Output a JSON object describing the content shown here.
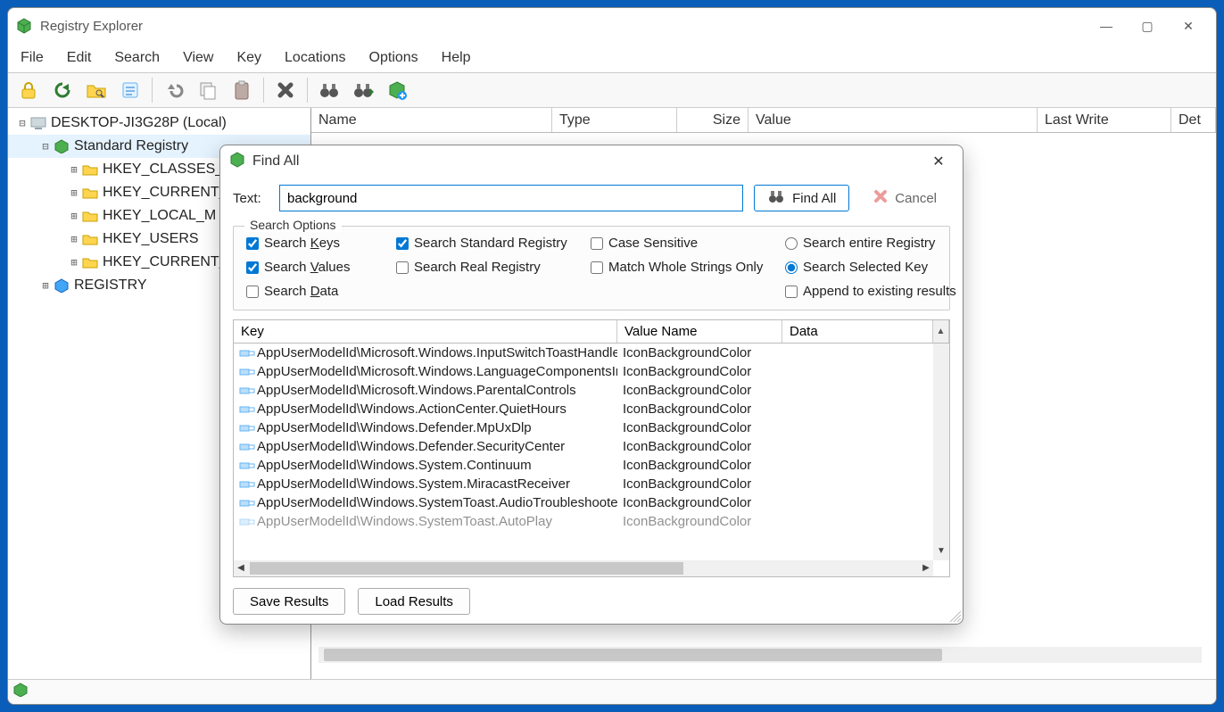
{
  "app": {
    "title": "Registry Explorer"
  },
  "window_controls": {
    "min": "—",
    "max": "▢",
    "close": "✕"
  },
  "menu": [
    "File",
    "Edit",
    "Search",
    "View",
    "Key",
    "Locations",
    "Options",
    "Help"
  ],
  "toolbar": {
    "icons": [
      "lock-icon",
      "refresh-icon",
      "folder-search-icon",
      "notes-icon",
      "undo-icon",
      "copy-icon",
      "paste-icon",
      "delete-icon",
      "binoculars-icon",
      "binoculars-next-icon",
      "cube-plus-icon"
    ]
  },
  "tree": {
    "root": "DESKTOP-JI3G28P (Local)",
    "standard": "Standard Registry",
    "hives": [
      "HKEY_CLASSES_",
      "HKEY_CURRENT_",
      "HKEY_LOCAL_M",
      "HKEY_USERS",
      "HKEY_CURRENT_"
    ],
    "registry": "REGISTRY"
  },
  "grid": {
    "cols": [
      "Name",
      "Type",
      "Size",
      "Value",
      "Last Write",
      "Det"
    ]
  },
  "dialog": {
    "title": "Find All",
    "text_label": "Text:",
    "text_value": "background",
    "find_btn": "Find All",
    "cancel_btn": "Cancel",
    "group_label": "Search Options",
    "opts": {
      "keys": "Search Keys",
      "values": "Search Values",
      "data": "Search Data",
      "std": "Search Standard Registry",
      "real": "Search Real Registry",
      "case": "Case Sensitive",
      "whole": "Match Whole Strings Only",
      "entire": "Search entire Registry",
      "selected": "Search Selected Key",
      "append": "Append to existing results"
    },
    "results_cols": [
      "Key",
      "Value Name",
      "Data"
    ],
    "results": [
      {
        "key": "AppUserModelId\\Microsoft.Windows.InputSwitchToastHandler",
        "val": "IconBackgroundColor",
        "data": ""
      },
      {
        "key": "AppUserModelId\\Microsoft.Windows.LanguageComponentsInstaller",
        "val": "IconBackgroundColor",
        "data": ""
      },
      {
        "key": "AppUserModelId\\Microsoft.Windows.ParentalControls",
        "val": "IconBackgroundColor",
        "data": ""
      },
      {
        "key": "AppUserModelId\\Windows.ActionCenter.QuietHours",
        "val": "IconBackgroundColor",
        "data": ""
      },
      {
        "key": "AppUserModelId\\Windows.Defender.MpUxDlp",
        "val": "IconBackgroundColor",
        "data": ""
      },
      {
        "key": "AppUserModelId\\Windows.Defender.SecurityCenter",
        "val": "IconBackgroundColor",
        "data": ""
      },
      {
        "key": "AppUserModelId\\Windows.System.Continuum",
        "val": "IconBackgroundColor",
        "data": ""
      },
      {
        "key": "AppUserModelId\\Windows.System.MiracastReceiver",
        "val": "IconBackgroundColor",
        "data": ""
      },
      {
        "key": "AppUserModelId\\Windows.SystemToast.AudioTroubleshooter",
        "val": "IconBackgroundColor",
        "data": ""
      },
      {
        "key": "AppUserModelId\\Windows.SystemToast.AutoPlay",
        "val": "IconBackgroundColor",
        "data": ""
      }
    ],
    "save_btn": "Save Results",
    "load_btn": "Load Results"
  }
}
